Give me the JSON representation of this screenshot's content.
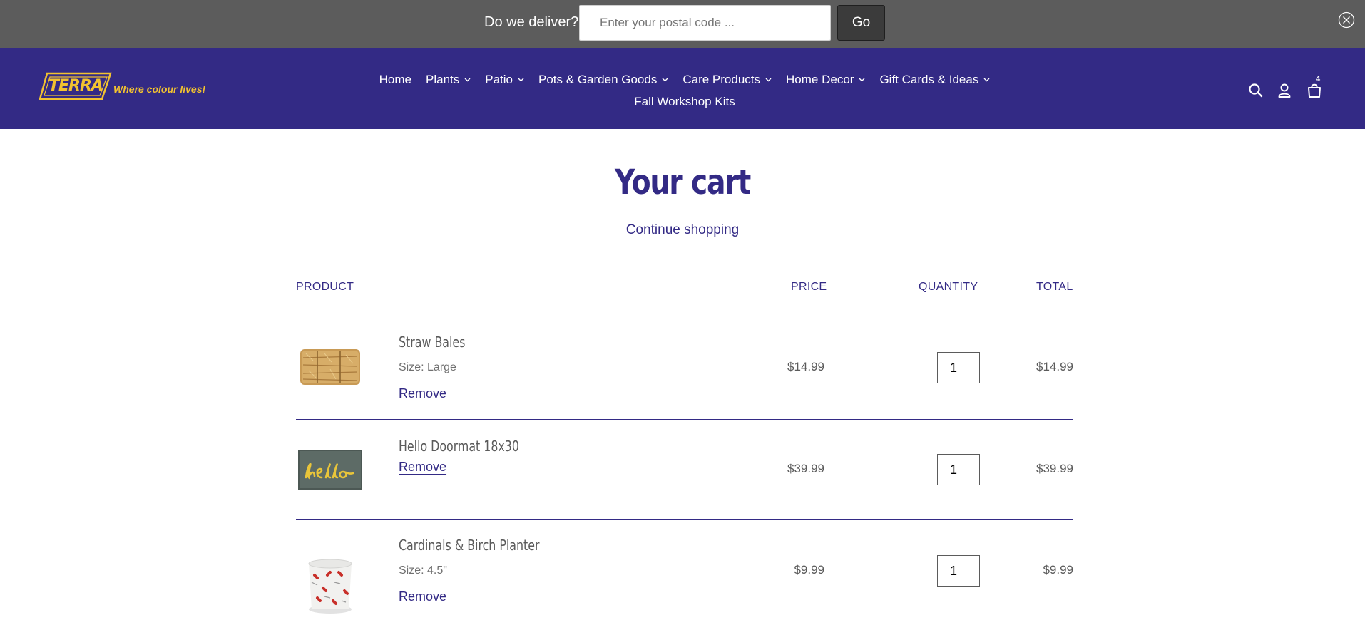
{
  "delivery_bar": {
    "label": "Do we deliver?",
    "postal_placeholder": "Enter your postal code ...",
    "go_label": "Go"
  },
  "header": {
    "logo_text": "TERRA",
    "tagline": "Where colour lives!",
    "nav_primary": [
      {
        "label": "Home",
        "has_dropdown": false
      },
      {
        "label": "Plants",
        "has_dropdown": true
      },
      {
        "label": "Patio",
        "has_dropdown": true
      },
      {
        "label": "Pots & Garden Goods",
        "has_dropdown": true
      },
      {
        "label": "Care Products",
        "has_dropdown": true
      },
      {
        "label": "Home Decor",
        "has_dropdown": true
      },
      {
        "label": "Gift Cards & Ideas",
        "has_dropdown": true
      }
    ],
    "nav_secondary": {
      "label": "Fall Workshop Kits"
    },
    "cart_count": "4",
    "icons": [
      "search-icon",
      "account-icon",
      "cart-icon"
    ]
  },
  "cart": {
    "title": "Your cart",
    "continue_label": "Continue shopping",
    "columns": {
      "product": "PRODUCT",
      "price": "PRICE",
      "quantity": "QUANTITY",
      "total": "TOTAL"
    },
    "items": [
      {
        "name": "Straw Bales",
        "variant": "Size: Large",
        "remove": "Remove",
        "price": "$14.99",
        "quantity": "1",
        "total": "$14.99"
      },
      {
        "name": "Hello Doormat 18x30",
        "variant": "",
        "remove": "Remove",
        "price": "$39.99",
        "quantity": "1",
        "total": "$39.99"
      },
      {
        "name": "Cardinals & Birch Planter",
        "variant": "Size: 4.5\"",
        "remove": "Remove",
        "price": "$9.99",
        "quantity": "1",
        "total": "$9.99"
      }
    ]
  },
  "colors": {
    "brand_purple": "#332a85",
    "logo_yellow": "#f2c230",
    "delivery_bar": "#5c5c5c"
  }
}
